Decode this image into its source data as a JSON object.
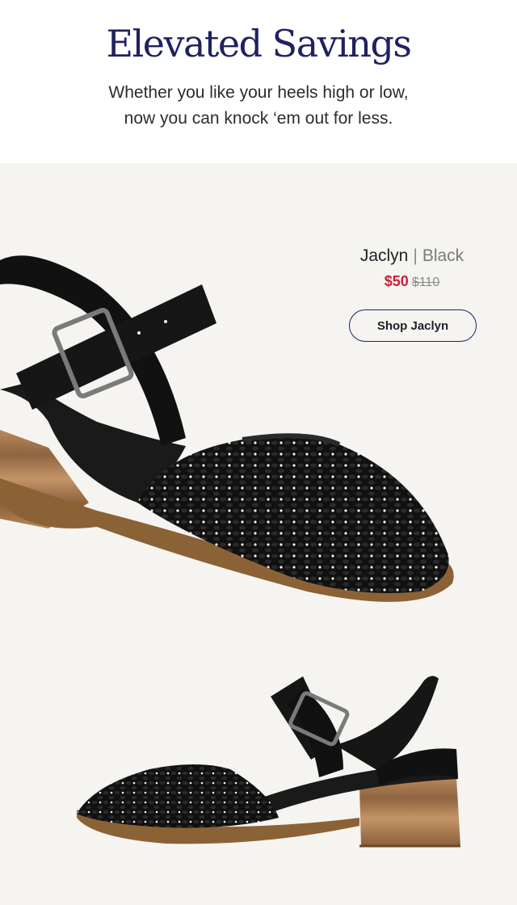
{
  "header": {
    "headline": "Elevated Savings",
    "subhead_line1": "Whether you like your heels high or low,",
    "subhead_line2": "now you can knock ‘em out for less."
  },
  "product": {
    "name": "Jaclyn",
    "separator": "|",
    "color": "Black",
    "sale_price": "$50",
    "original_price": "$110",
    "cta_label": "Shop Jaclyn",
    "image_1": "black woven closed-toe block heel sandal, three-quarter front view",
    "image_2": "black woven closed-toe block heel sandal, side profile view"
  },
  "colors": {
    "headline": "#1f2160",
    "sale_price": "#c4213a",
    "panel_background": "#f6f4f0"
  }
}
